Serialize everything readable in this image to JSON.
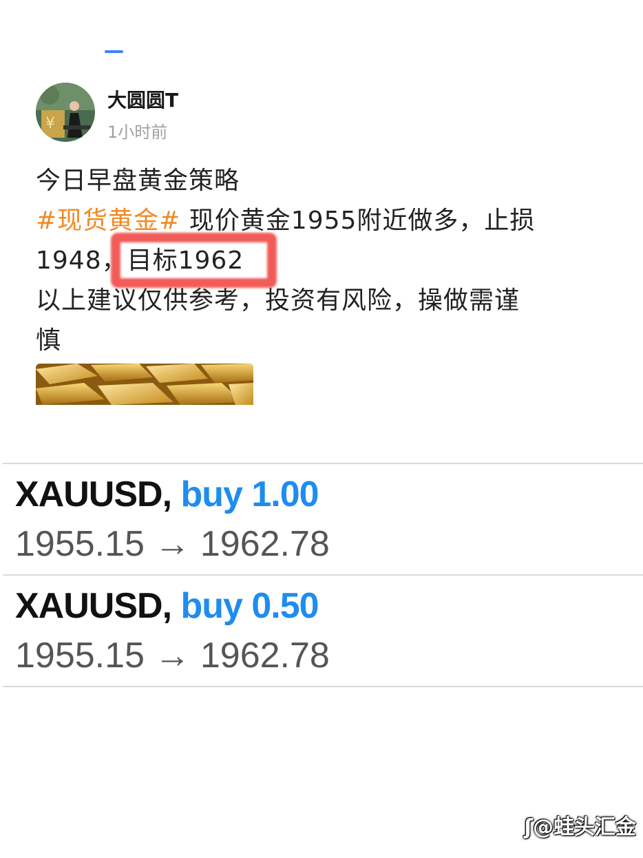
{
  "post": {
    "username": "大圆圆T",
    "time": "1小时前",
    "title": "今日早盘黄金策略",
    "hashtag": "#现货黄金#",
    "line2_rest": " 现价黄金1955附近做多，止损",
    "line3_prefix": "1948，",
    "line3_target": "目标1962",
    "line4": "以上建议仅供参考，投资有风险，操做需谨",
    "line5": "慎"
  },
  "trades": [
    {
      "symbol": "XAUUSD,",
      "action": "buy 1.00",
      "prices": "1955.15 → 1962.78"
    },
    {
      "symbol": "XAUUSD,",
      "action": "buy 0.50",
      "prices": "1955.15 → 1962.78"
    }
  ],
  "watermark": "@蛙头汇金",
  "colors": {
    "hashtag": "#f08a24",
    "action": "#1f8cf0",
    "highlight": "#f0403c",
    "tab_indicator": "#3b82f6"
  }
}
